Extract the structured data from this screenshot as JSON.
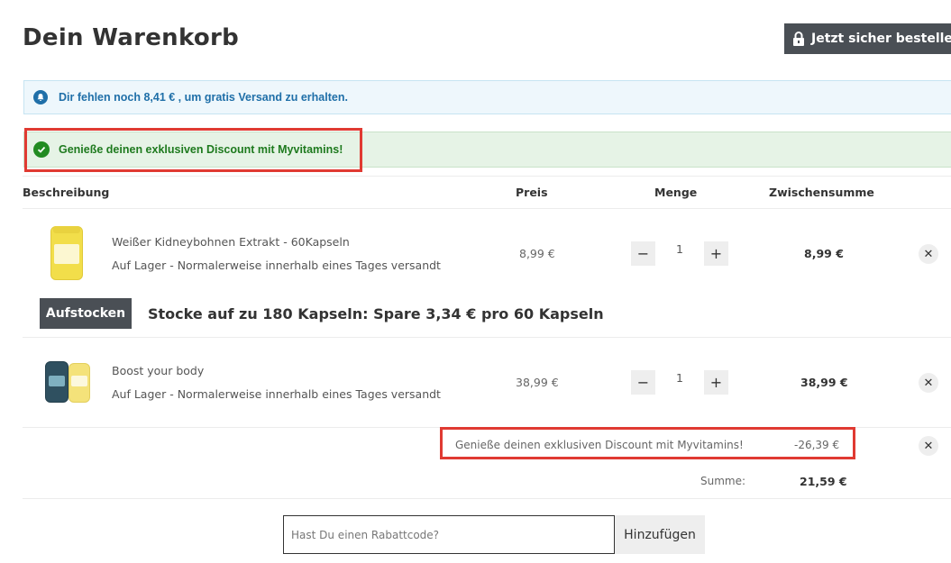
{
  "header": {
    "title": "Dein Warenkorb",
    "checkout_button": "Jetzt sicher bestellen"
  },
  "banners": {
    "shipping_info": "Dir fehlen noch 8,41 € , um gratis Versand zu erhalten.",
    "discount_success": "Genieße deinen exklusiven Discount mit Myvitamins!"
  },
  "table": {
    "columns": [
      "Beschreibung",
      "Preis",
      "Menge",
      "Zwischensumme"
    ]
  },
  "items": [
    {
      "name": "Weißer Kidneybohnen Extrakt - 60Kapseln",
      "stock": "Auf Lager  -  Normalerweise innerhalb eines Tages versandt",
      "price": "8,99 €",
      "quantity": "1",
      "subtotal": "8,99 €"
    },
    {
      "name": "Boost your body",
      "stock": "Auf Lager  -  Normalerweise innerhalb eines Tages versandt",
      "price": "38,99 €",
      "quantity": "1",
      "subtotal": "38,99 €"
    }
  ],
  "upsell": {
    "button": "Aufstocken",
    "text": "Stocke auf zu 180 Kapseln: Spare 3,34 € pro 60 Kapseln"
  },
  "discount": {
    "label": "Genieße deinen exklusiven Discount mit Myvitamins!",
    "value": "-26,39 €"
  },
  "summary": {
    "label": "Summe:",
    "value": "21,59 €"
  },
  "coupon": {
    "placeholder": "Hast Du einen Rabattcode?",
    "button": "Hinzufügen"
  },
  "controls": {
    "minus": "−",
    "plus": "+",
    "remove": "✕"
  },
  "colors": {
    "dark_button": "#4a4f55",
    "info_bg": "#eef7fc",
    "info_text": "#1f6fa8",
    "success_bg": "#e6f3e6",
    "success_text": "#1e7a1e",
    "highlight": "#e03a32"
  }
}
